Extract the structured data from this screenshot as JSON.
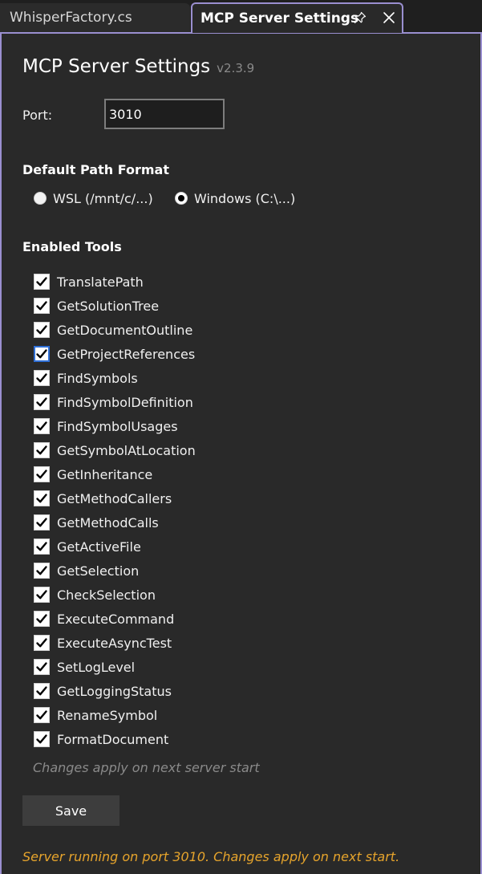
{
  "tabs": {
    "inactive_label": "WhisperFactory.cs",
    "active_label": "MCP Server Settings",
    "pin_icon": "pin-icon",
    "close_icon": "close-icon"
  },
  "panel": {
    "title": "MCP Server Settings",
    "version": "v2.3.9",
    "port_label": "Port:",
    "port_value": "3010"
  },
  "path_format": {
    "heading": "Default Path Format",
    "options": [
      {
        "label": "WSL (/mnt/c/...)",
        "selected": false
      },
      {
        "label": "Windows (C:\\...)",
        "selected": true
      }
    ]
  },
  "tools": {
    "heading": "Enabled Tools",
    "items": [
      {
        "label": "TranslatePath",
        "checked": true
      },
      {
        "label": "GetSolutionTree",
        "checked": true
      },
      {
        "label": "GetDocumentOutline",
        "checked": true
      },
      {
        "label": "GetProjectReferences",
        "checked": true,
        "focused": true
      },
      {
        "label": "FindSymbols",
        "checked": true
      },
      {
        "label": "FindSymbolDefinition",
        "checked": true
      },
      {
        "label": "FindSymbolUsages",
        "checked": true
      },
      {
        "label": "GetSymbolAtLocation",
        "checked": true
      },
      {
        "label": "GetInheritance",
        "checked": true
      },
      {
        "label": "GetMethodCallers",
        "checked": true
      },
      {
        "label": "GetMethodCalls",
        "checked": true
      },
      {
        "label": "GetActiveFile",
        "checked": true
      },
      {
        "label": "GetSelection",
        "checked": true
      },
      {
        "label": "CheckSelection",
        "checked": true
      },
      {
        "label": "ExecuteCommand",
        "checked": true
      },
      {
        "label": "ExecuteAsyncTest",
        "checked": true
      },
      {
        "label": "SetLogLevel",
        "checked": true
      },
      {
        "label": "GetLoggingStatus",
        "checked": true
      },
      {
        "label": "RenameSymbol",
        "checked": true
      },
      {
        "label": "FormatDocument",
        "checked": true
      }
    ]
  },
  "hint": "Changes apply on next server start",
  "save_label": "Save",
  "status": "Server running on port 3010. Changes apply on next start.",
  "colors": {
    "accent_border": "#9a8fd0",
    "status": "#e6a42c",
    "focus": "#2f6fd6"
  }
}
